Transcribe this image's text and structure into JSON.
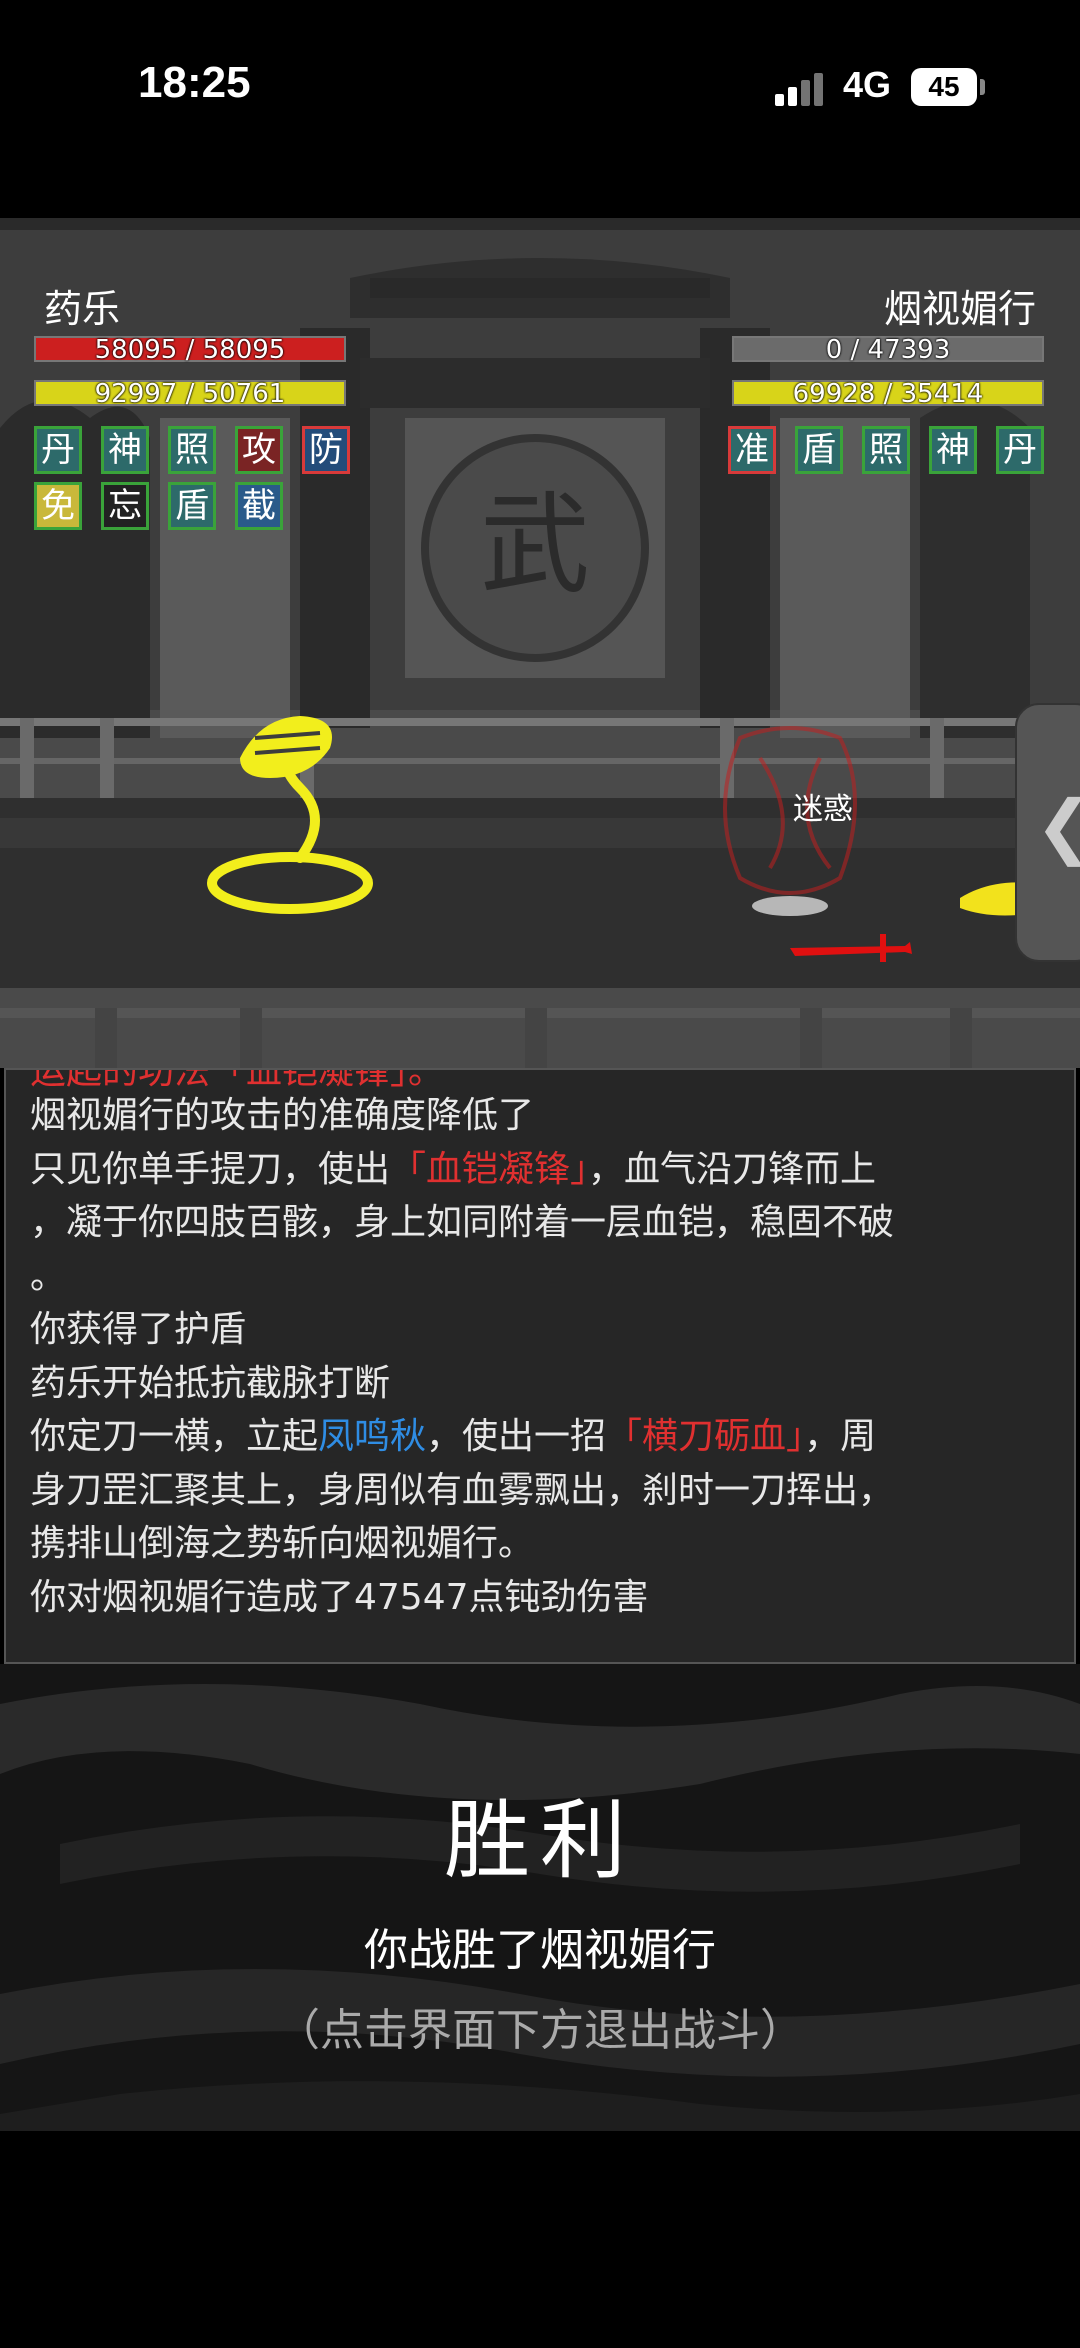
{
  "status_bar": {
    "time": "18:25",
    "network": "4G",
    "battery": "45"
  },
  "player": {
    "name": "药乐",
    "hp_text": "58095 / 58095",
    "hp_fraction": 1.0,
    "mp_text": "92997 / 50761",
    "mp_fraction": 1.0,
    "buffs": [
      "丹",
      "神",
      "照",
      "攻",
      "防",
      "免",
      "忘",
      "盾",
      "截"
    ]
  },
  "enemy": {
    "name": "烟视媚行",
    "hp_text": "0 / 47393",
    "hp_fraction": 0.0,
    "mp_text": "69928 / 35414",
    "mp_fraction": 1.0,
    "buffs": [
      "准",
      "盾",
      "照",
      "神",
      "丹"
    ],
    "status": "迷惑"
  },
  "scene": {
    "banner_glyph": "武",
    "side_tab": "❮"
  },
  "log": {
    "cut_line": "运起的功法「血铠凝锋」。",
    "l1": "烟视媚行的攻击的准确度降低了",
    "l2a": "只见你单手提刀，使出",
    "l2b": "「血铠凝锋」",
    "l2c": "，血气沿刀锋而上",
    "l3": "，凝于你四肢百骸，身上如同附着一层血铠，稳固不破",
    "l4": "。",
    "l5": "你获得了护盾",
    "l6": "药乐开始抵抗截脉打断",
    "l7a": "你定刀一横，立起",
    "l7b": "凤鸣秋",
    "l7c": "，使出一招",
    "l7d": "「横刀砺血」",
    "l7e": "，周",
    "l8": "身刀罡汇聚其上，身周似有血雾飘出，刹时一刀挥出，",
    "l9": "携排山倒海之势斩向烟视媚行。",
    "l10": "你对烟视媚行造成了47547点钝劲伤害"
  },
  "result": {
    "title": "胜利",
    "subtitle": "你战胜了烟视媚行",
    "hint": "（点击界面下方退出战斗）"
  },
  "colors": {
    "hp": "#cc1f1f",
    "mp": "#d8d419",
    "snake": "#f2ee1c",
    "highlight_red": "#e03030",
    "highlight_blue": "#2f8de4"
  }
}
